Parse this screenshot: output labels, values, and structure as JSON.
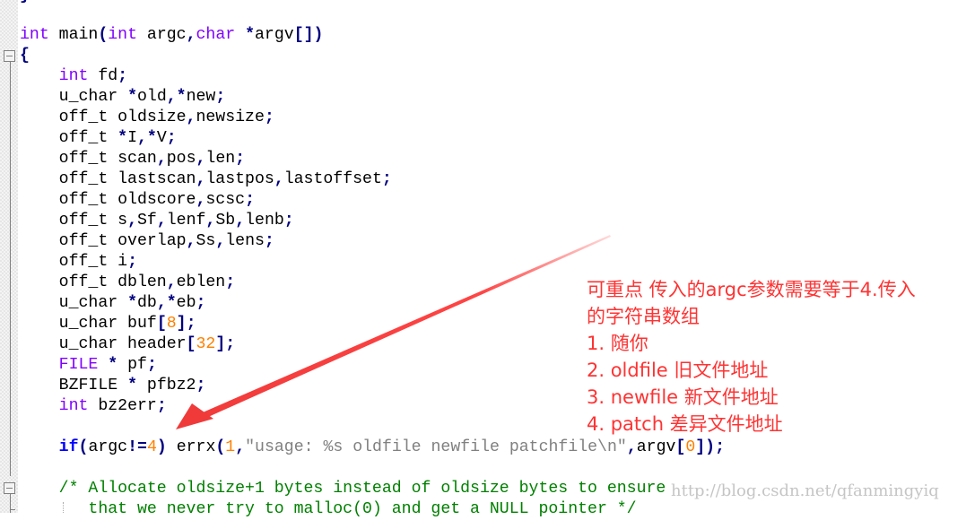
{
  "editor": {
    "language": "C",
    "lines": [
      {
        "tokens": [
          {
            "t": "}",
            "c": "op"
          }
        ]
      },
      {
        "tokens": []
      },
      {
        "tokens": [
          {
            "t": "int",
            "c": "kw"
          },
          {
            "t": " main"
          },
          {
            "t": "(",
            "c": "op"
          },
          {
            "t": "int",
            "c": "kw"
          },
          {
            "t": " argc"
          },
          {
            "t": ",",
            "c": "op"
          },
          {
            "t": "char",
            "c": "kw"
          },
          {
            "t": " "
          },
          {
            "t": "*",
            "c": "op"
          },
          {
            "t": "argv"
          },
          {
            "t": "[])",
            "c": "op"
          }
        ]
      },
      {
        "tokens": [
          {
            "t": "{",
            "c": "op"
          }
        ]
      },
      {
        "tokens": [
          {
            "t": "    "
          },
          {
            "t": "int",
            "c": "kw"
          },
          {
            "t": " fd"
          },
          {
            "t": ";",
            "c": "op"
          }
        ]
      },
      {
        "tokens": [
          {
            "t": "    u_char "
          },
          {
            "t": "*",
            "c": "op"
          },
          {
            "t": "old"
          },
          {
            "t": ",*",
            "c": "op"
          },
          {
            "t": "new"
          },
          {
            "t": ";",
            "c": "op"
          }
        ]
      },
      {
        "tokens": [
          {
            "t": "    off_t oldsize"
          },
          {
            "t": ",",
            "c": "op"
          },
          {
            "t": "newsize"
          },
          {
            "t": ";",
            "c": "op"
          }
        ]
      },
      {
        "tokens": [
          {
            "t": "    off_t "
          },
          {
            "t": "*",
            "c": "op"
          },
          {
            "t": "I"
          },
          {
            "t": ",*",
            "c": "op"
          },
          {
            "t": "V"
          },
          {
            "t": ";",
            "c": "op"
          }
        ]
      },
      {
        "tokens": [
          {
            "t": "    off_t scan"
          },
          {
            "t": ",",
            "c": "op"
          },
          {
            "t": "pos"
          },
          {
            "t": ",",
            "c": "op"
          },
          {
            "t": "len"
          },
          {
            "t": ";",
            "c": "op"
          }
        ]
      },
      {
        "tokens": [
          {
            "t": "    off_t lastscan"
          },
          {
            "t": ",",
            "c": "op"
          },
          {
            "t": "lastpos"
          },
          {
            "t": ",",
            "c": "op"
          },
          {
            "t": "lastoffset"
          },
          {
            "t": ";",
            "c": "op"
          }
        ]
      },
      {
        "tokens": [
          {
            "t": "    off_t oldscore"
          },
          {
            "t": ",",
            "c": "op"
          },
          {
            "t": "scsc"
          },
          {
            "t": ";",
            "c": "op"
          }
        ]
      },
      {
        "tokens": [
          {
            "t": "    off_t s"
          },
          {
            "t": ",",
            "c": "op"
          },
          {
            "t": "Sf"
          },
          {
            "t": ",",
            "c": "op"
          },
          {
            "t": "lenf"
          },
          {
            "t": ",",
            "c": "op"
          },
          {
            "t": "Sb"
          },
          {
            "t": ",",
            "c": "op"
          },
          {
            "t": "lenb"
          },
          {
            "t": ";",
            "c": "op"
          }
        ]
      },
      {
        "tokens": [
          {
            "t": "    off_t overlap"
          },
          {
            "t": ",",
            "c": "op"
          },
          {
            "t": "Ss"
          },
          {
            "t": ",",
            "c": "op"
          },
          {
            "t": "lens"
          },
          {
            "t": ";",
            "c": "op"
          }
        ]
      },
      {
        "tokens": [
          {
            "t": "    off_t i"
          },
          {
            "t": ";",
            "c": "op"
          }
        ]
      },
      {
        "tokens": [
          {
            "t": "    off_t dblen"
          },
          {
            "t": ",",
            "c": "op"
          },
          {
            "t": "eblen"
          },
          {
            "t": ";",
            "c": "op"
          }
        ]
      },
      {
        "tokens": [
          {
            "t": "    u_char "
          },
          {
            "t": "*",
            "c": "op"
          },
          {
            "t": "db"
          },
          {
            "t": ",*",
            "c": "op"
          },
          {
            "t": "eb"
          },
          {
            "t": ";",
            "c": "op"
          }
        ]
      },
      {
        "tokens": [
          {
            "t": "    u_char buf"
          },
          {
            "t": "[",
            "c": "op"
          },
          {
            "t": "8",
            "c": "num"
          },
          {
            "t": "];",
            "c": "op"
          }
        ]
      },
      {
        "tokens": [
          {
            "t": "    u_char header"
          },
          {
            "t": "[",
            "c": "op"
          },
          {
            "t": "32",
            "c": "num"
          },
          {
            "t": "];",
            "c": "op"
          }
        ]
      },
      {
        "tokens": [
          {
            "t": "    "
          },
          {
            "t": "FILE",
            "c": "kw"
          },
          {
            "t": " "
          },
          {
            "t": "*",
            "c": "op"
          },
          {
            "t": " pf"
          },
          {
            "t": ";",
            "c": "op"
          }
        ]
      },
      {
        "tokens": [
          {
            "t": "    BZFILE "
          },
          {
            "t": "*",
            "c": "op"
          },
          {
            "t": " pfbz2"
          },
          {
            "t": ";",
            "c": "op"
          }
        ]
      },
      {
        "tokens": [
          {
            "t": "    "
          },
          {
            "t": "int",
            "c": "kw"
          },
          {
            "t": " bz2err"
          },
          {
            "t": ";",
            "c": "op"
          }
        ]
      },
      {
        "tokens": []
      },
      {
        "tokens": [
          {
            "t": "    "
          },
          {
            "t": "if",
            "c": "kw2"
          },
          {
            "t": "(",
            "c": "op"
          },
          {
            "t": "argc"
          },
          {
            "t": "!=",
            "c": "op"
          },
          {
            "t": "4",
            "c": "num"
          },
          {
            "t": ")",
            "c": "op"
          },
          {
            "t": " errx"
          },
          {
            "t": "(",
            "c": "op"
          },
          {
            "t": "1",
            "c": "num"
          },
          {
            "t": ",",
            "c": "op"
          },
          {
            "t": "\"usage: %s oldfile newfile patchfile\\n\"",
            "c": "str"
          },
          {
            "t": ",",
            "c": "op"
          },
          {
            "t": "argv"
          },
          {
            "t": "[",
            "c": "op"
          },
          {
            "t": "0",
            "c": "num"
          },
          {
            "t": "]);",
            "c": "op"
          }
        ]
      },
      {
        "tokens": []
      },
      {
        "tokens": [
          {
            "t": "    /* Allocate oldsize+1 bytes instead of oldsize bytes to ensure",
            "c": "cmt"
          }
        ]
      },
      {
        "tokens": [
          {
            "t": "       that we never try to malloc(0) and get a NULL pointer */",
            "c": "cmt"
          }
        ]
      }
    ]
  },
  "annotation": {
    "lines": [
      "可重点 传入的argc参数需要等于4.传入",
      "的字符串数组",
      "1. 随你",
      "2. oldfile 旧文件地址",
      "3. newfile 新文件地址",
      "4. patch 差异文件地址"
    ],
    "color": "#ff3333"
  },
  "watermark": "http://blog.csdn.net/qfanmingyiq"
}
